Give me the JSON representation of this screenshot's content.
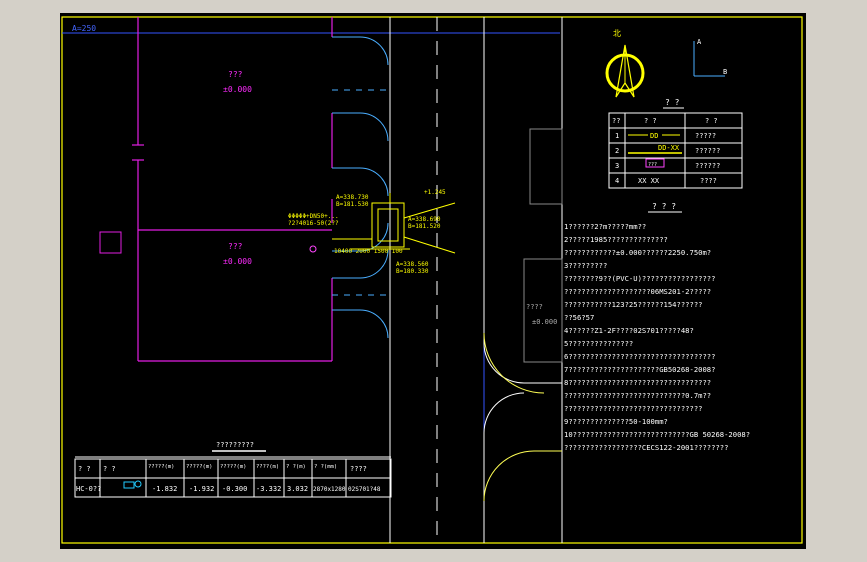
{
  "drawing": {
    "axis_label": "A=250",
    "room1": {
      "name": "???",
      "level": "±0.000"
    },
    "room2": {
      "name": "???",
      "level": "±0.000"
    },
    "room3": {
      "name": "????",
      "level": "±0.000"
    },
    "coords": {
      "c1": "A=338.730",
      "c2": "B=181.530",
      "c3": "A=338.690",
      "c4": "B=181.520",
      "c5": "A=338.560",
      "c6": "B=180.330",
      "c7": "+1.245",
      "c8": "ΦΦΦΦΦ+DN50+...",
      "c9": "?2?4016-50(2??",
      "c10": "10400  2000   1500  100"
    },
    "north": {
      "label": "北",
      "axis_a": "A",
      "axis_b": "B"
    }
  },
  "legend": {
    "title": "? ?",
    "headers": [
      "??",
      "? ?",
      "? ?"
    ],
    "rows": [
      {
        "num": "1",
        "symbol": "DD",
        "desc": "?????"
      },
      {
        "num": "2",
        "symbol": "DD-XX",
        "desc": "??????"
      },
      {
        "num": "3",
        "symbol": "???",
        "desc": "??????"
      },
      {
        "num": "4",
        "symbol": "XX XX",
        "desc": "????"
      }
    ]
  },
  "notes": {
    "title": "? ? ?",
    "lines": [
      "1??????2?m?????mm??",
      "2?????1985??????????????",
      "  ????????????±0.000??????2250.750m?",
      "3?????????",
      "  ????????9??(PVC-U)?????????????????",
      "  ????????????????????06MS201-2?????",
      "  ???????????123?25??????154??????",
      "  ??56?57",
      "4??????Z1-2F????02S701?????48?",
      "5???????????????",
      "6??????????????????????????????????",
      "7?????????????????????GB50268-2008?",
      "8?????????????????????????????????",
      "  ????????????????????????????0.7m??",
      "  ????????????????????????????????",
      "9??????????????50-100mm?",
      "10???????????????????????????GB 50268-2008?",
      "  ??????????????????CECS122-2001????????"
    ]
  },
  "schedule": {
    "title": "?????????",
    "headers": [
      "? ?",
      "? ?",
      "?????(m)",
      "?????(m)",
      "?????(m)",
      "????(m)",
      "? ?(m)",
      "? ?(mm)",
      "????"
    ],
    "row": [
      "HC-0??",
      "",
      "-1.832",
      "-1.932",
      "-0.300",
      "-3.332",
      "3.032",
      "2870x1280",
      "02S701?48"
    ]
  }
}
